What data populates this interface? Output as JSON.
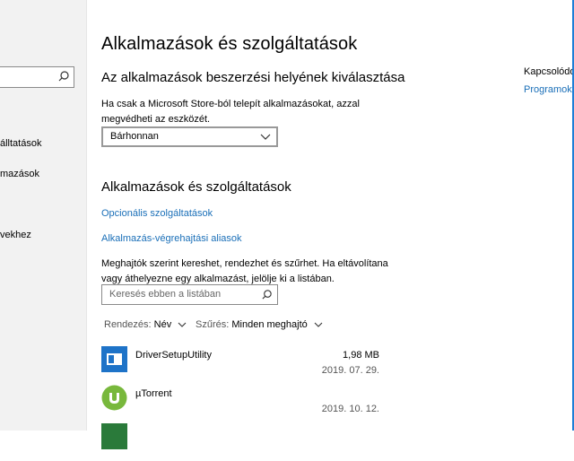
{
  "nav": {
    "items": [
      {
        "label": "álltatások"
      },
      {
        "label": "mazások"
      },
      {
        "label": "vekhez"
      }
    ]
  },
  "page": {
    "title": "Alkalmazások és szolgáltatások"
  },
  "source": {
    "heading": "Az alkalmazások beszerzési helyének kiválasztása",
    "description": "Ha csak a Microsoft Store-ból telepít alkalmazásokat, azzal megvédheti az eszközét.",
    "dropdown_value": "Bárhonnan"
  },
  "apps_section": {
    "heading": "Alkalmazások és szolgáltatások",
    "link_optional": "Opcionális szolgáltatások",
    "link_aliases": "Alkalmazás-végrehajtási aliasok",
    "description": "Meghajtók szerint kereshet, rendezhet és szűrhet. Ha eltávolítana vagy áthelyezne egy alkalmazást, jelölje ki a listában.",
    "search_placeholder": "Keresés ebben a listában",
    "sort_label": "Rendezés:",
    "sort_value": "Név",
    "filter_label": "Szűrés:",
    "filter_value": "Minden meghajtó",
    "apps": [
      {
        "name": "DriverSetupUtility",
        "size": "1,98 MB",
        "date": "2019. 07. 29.",
        "icon": "driver-setup-icon"
      },
      {
        "name": "µTorrent",
        "size": "",
        "date": "2019. 10. 12.",
        "icon": "utorrent-icon"
      }
    ]
  },
  "related": {
    "title": "Kapcsolódó",
    "link": "Programok é"
  },
  "colors": {
    "accent": "#1a6fb8",
    "window_border": "#1f7fd6",
    "nav_bg": "#f2f2f2"
  }
}
